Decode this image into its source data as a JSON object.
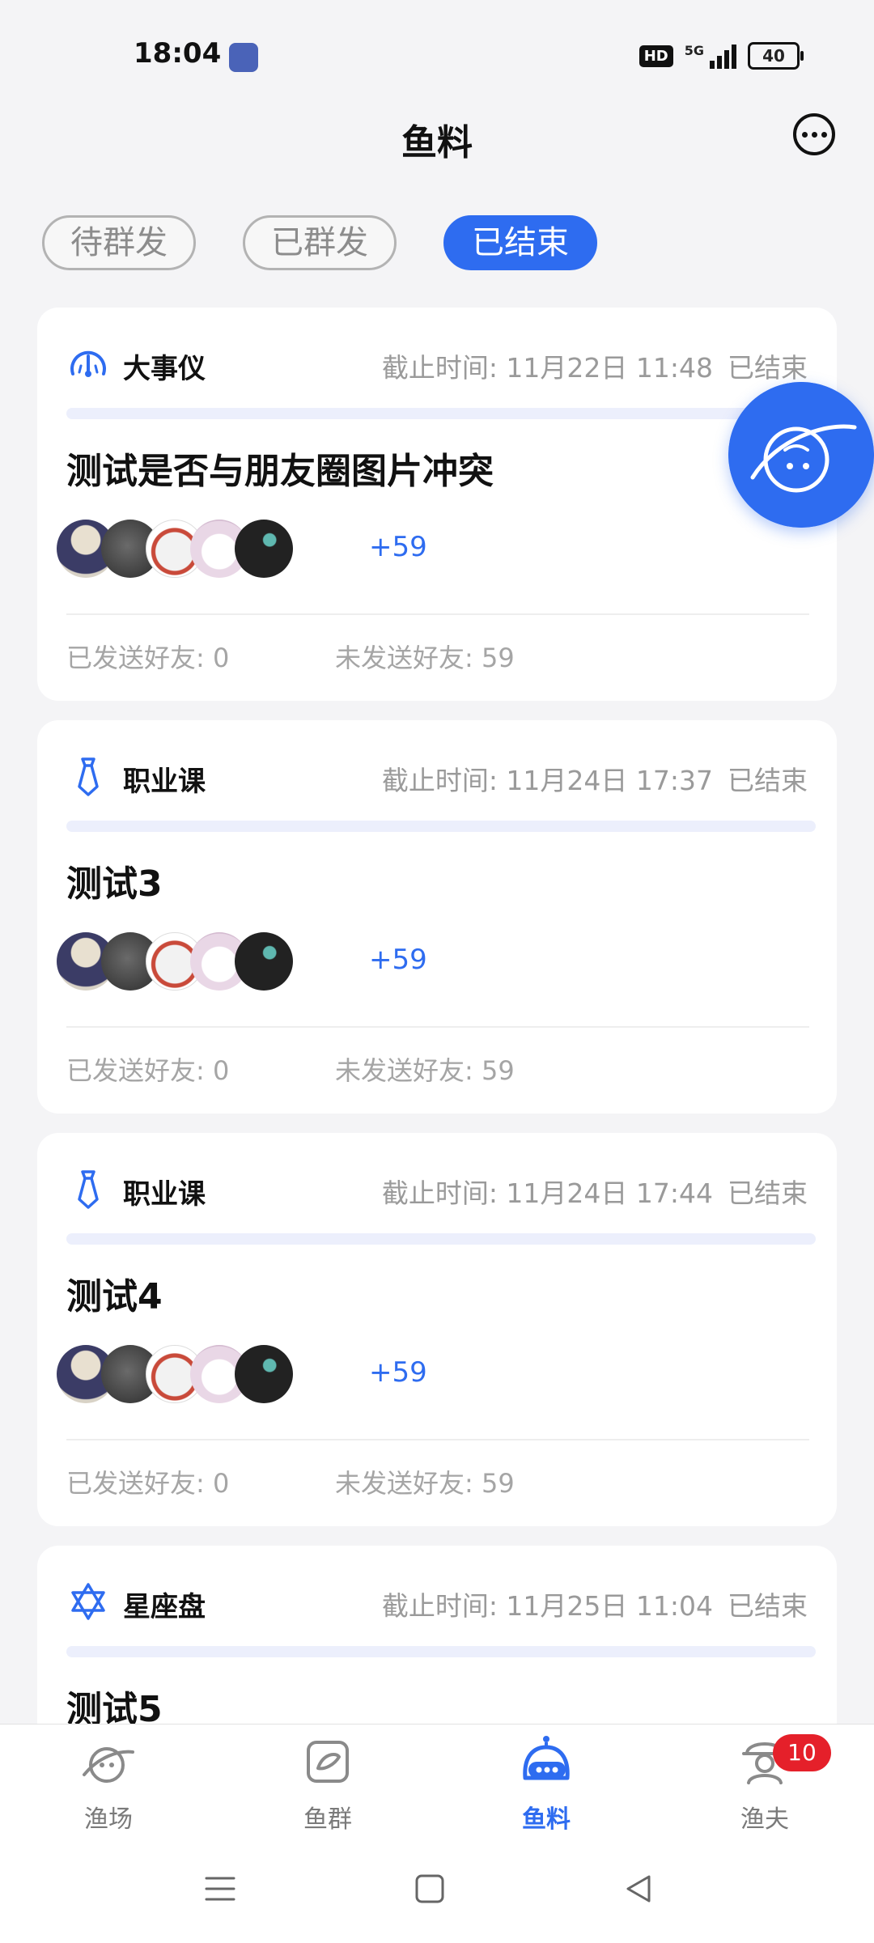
{
  "status_bar": {
    "time": "18:04",
    "network": "5G",
    "hd": "HD",
    "battery": "40"
  },
  "header": {
    "title": "鱼料"
  },
  "tabs": [
    {
      "label": "待群发",
      "active": false
    },
    {
      "label": "已群发",
      "active": false
    },
    {
      "label": "已结束",
      "active": true
    }
  ],
  "cards": [
    {
      "category": "大事仪",
      "icon": "dashboard-gauge-icon",
      "deadline": "截止时间: 11月22日 11:48",
      "status": "已结束",
      "title": "测试是否与朋友圈图片冲突",
      "more_count": "+59",
      "sent": "已发送好友: 0",
      "unsent": "未发送好友: 59"
    },
    {
      "category": "职业课",
      "icon": "necktie-icon",
      "deadline": "截止时间: 11月24日 17:37",
      "status": "已结束",
      "title": "测试3",
      "more_count": "+59",
      "sent": "已发送好友: 0",
      "unsent": "未发送好友: 59"
    },
    {
      "category": "职业课",
      "icon": "necktie-icon",
      "deadline": "截止时间: 11月24日 17:44",
      "status": "已结束",
      "title": "测试4",
      "more_count": "+59",
      "sent": "已发送好友: 0",
      "unsent": "未发送好友: 59"
    },
    {
      "category": "星座盘",
      "icon": "star-of-david-icon",
      "deadline": "截止时间: 11月25日 11:04",
      "status": "已结束",
      "title": "测试5"
    }
  ],
  "nav": [
    {
      "label": "渔场",
      "icon": "planet-fishing-icon",
      "active": false
    },
    {
      "label": "鱼群",
      "icon": "fish-group-icon",
      "active": false
    },
    {
      "label": "鱼料",
      "icon": "robot-bait-icon",
      "active": true
    },
    {
      "label": "渔夫",
      "icon": "fisherman-icon",
      "active": false,
      "badge": "10"
    }
  ],
  "colors": {
    "accent": "#2e6cf0",
    "badge": "#e5202a",
    "background": "#f4f4f6"
  }
}
